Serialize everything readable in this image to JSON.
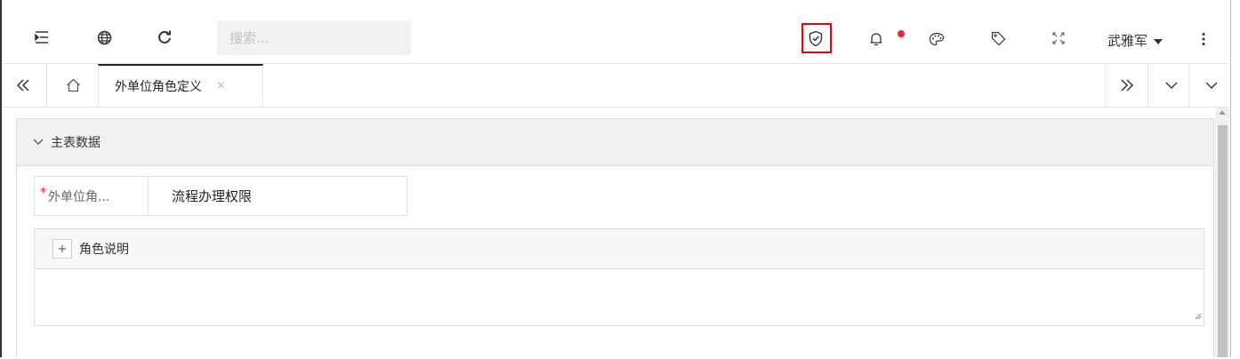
{
  "toolbar": {
    "search_placeholder": "搜索...",
    "user_name": "武雅军",
    "notification_dot_color": "#f5222d",
    "highlight_color": "#e00000",
    "icons": [
      "menu-fold-icon",
      "globe-icon",
      "refresh-icon",
      "shield-check-icon",
      "bell-icon",
      "palette-icon",
      "tag-icon",
      "fullscreen-icon",
      "caret-down-icon",
      "more-vertical-icon"
    ]
  },
  "tabs": {
    "active": {
      "label": "外单位角色定义",
      "close": "×"
    },
    "icons": [
      "double-left-icon",
      "home-icon",
      "double-right-icon",
      "chevron-down-icon"
    ]
  },
  "panel": {
    "title": "主表数据",
    "field": {
      "required_mark": "*",
      "label": "外单位角...",
      "value": "流程办理权限"
    },
    "description": {
      "add_label": "+",
      "label": "角色说明"
    }
  }
}
